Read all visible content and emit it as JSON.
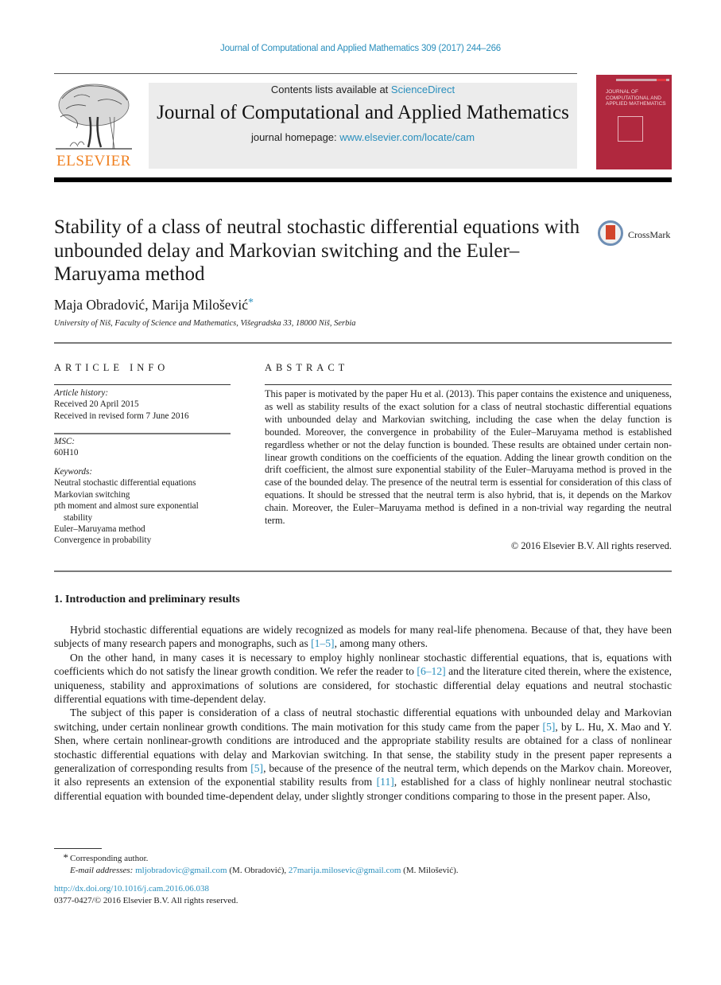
{
  "running_head": "Journal of Computational and Applied Mathematics 309 (2017) 244–266",
  "masthead": {
    "publisher_logo_text": "ELSEVIER",
    "contents_prefix": "Contents lists available at ",
    "contents_link": "ScienceDirect",
    "journal_name": "Journal of Computational and Applied Mathematics",
    "homepage_prefix": "journal homepage: ",
    "homepage_link": "www.elsevier.com/locate/cam",
    "cover_title": "JOURNAL OF COMPUTATIONAL AND APPLIED MATHEMATICS"
  },
  "article": {
    "title": "Stability of a class of neutral stochastic differential equations with unbounded delay and Markovian switching and the Euler–Maruyama method",
    "crossmark_label": "CrossMark",
    "authors": "Maja Obradović, Marija Milošević",
    "corresponding_marker": "*",
    "affiliation": "University of Niš, Faculty of Science and Mathematics, Višegradska 33, 18000 Niš, Serbia"
  },
  "article_info": {
    "heading": "ARTICLE INFO",
    "history_label": "Article history:",
    "history": [
      "Received 20 April 2015",
      "Received in revised form 7 June 2016"
    ],
    "msc_label": "MSC:",
    "msc": "60H10",
    "keywords_label": "Keywords:",
    "keywords": [
      "Neutral stochastic differential equations",
      "Markovian switching",
      "pth moment and almost sure exponential",
      "stability",
      "Euler–Maruyama method",
      "Convergence in probability"
    ]
  },
  "abstract": {
    "heading": "ABSTRACT",
    "text": "This paper is motivated by the paper Hu et al. (2013). This paper contains the existence and uniqueness, as well as stability results of the exact solution for a class of neutral stochastic differential equations with unbounded delay and Markovian switching, including the case when the delay function is bounded. Moreover, the convergence in probability of the Euler–Maruyama method is established regardless whether or not the delay function is bounded. These results are obtained under certain non-linear growth conditions on the coefficients of the equation. Adding the linear growth condition on the drift coefficient, the almost sure exponential stability of the Euler–Maruyama method is proved in the case of the bounded delay. The presence of the neutral term is essential for consideration of this class of equations. It should be stressed that the neutral term is also hybrid, that is, it depends on the Markov chain. Moreover, the Euler–Maruyama method is defined in a non-trivial way regarding the neutral term.",
    "copyright": "© 2016 Elsevier B.V. All rights reserved."
  },
  "section": {
    "heading": "1.  Introduction and preliminary results",
    "paragraphs": [
      {
        "parts": [
          {
            "t": "Hybrid stochastic differential equations are widely recognized as models for many real-life phenomena. Because of that, they have been subjects of many research papers and monographs, such as "
          },
          {
            "ref": "[1–5]"
          },
          {
            "t": ", among many others."
          }
        ]
      },
      {
        "parts": [
          {
            "t": "On the other hand, in many cases it is necessary to employ highly nonlinear stochastic differential equations, that is, equations with coefficients which do not satisfy the linear growth condition. We refer the reader to "
          },
          {
            "ref": "[6–12]"
          },
          {
            "t": " and the literature cited therein, where the existence, uniqueness, stability and approximations of solutions are considered, for stochastic differential delay equations and neutral stochastic differential equations with time-dependent delay."
          }
        ]
      },
      {
        "parts": [
          {
            "t": "The subject of this paper is consideration of a class of neutral stochastic differential equations with unbounded delay and Markovian switching, under certain nonlinear growth conditions. The main motivation for this study came from the paper "
          },
          {
            "ref": "[5]"
          },
          {
            "t": ", by L. Hu, X. Mao and Y. Shen, where certain nonlinear-growth conditions are introduced and the appropriate stability results are obtained for a class of nonlinear stochastic differential equations with delay and Markovian switching. In that sense, the stability study in the present paper represents a generalization of corresponding results from "
          },
          {
            "ref": "[5]"
          },
          {
            "t": ", because of the presence of the neutral term, which depends on the Markov chain. Moreover, it also represents an extension of the exponential stability results from "
          },
          {
            "ref": "[11]"
          },
          {
            "t": ", established for a class of highly nonlinear neutral stochastic differential equation with bounded time-dependent delay, under slightly stronger conditions comparing to those in the present paper. Also,"
          }
        ]
      }
    ]
  },
  "footnote": {
    "marker": "*",
    "corresponding": "Corresponding author.",
    "email_label": "E-mail addresses: ",
    "email1": "mljobradovic@gmail.com",
    "email1_owner": " (M. Obradović), ",
    "email2": "27marija.milosevic@gmail.com",
    "email2_owner": " (M. Milošević)."
  },
  "doi": {
    "link": "http://dx.doi.org/10.1016/j.cam.2016.06.038",
    "issn_copyright": "0377-0427/© 2016 Elsevier B.V. All rights reserved."
  },
  "colors": {
    "link": "#2a8fbd",
    "elsevier_orange": "#f07f1e",
    "cover_red": "#b0283e"
  }
}
